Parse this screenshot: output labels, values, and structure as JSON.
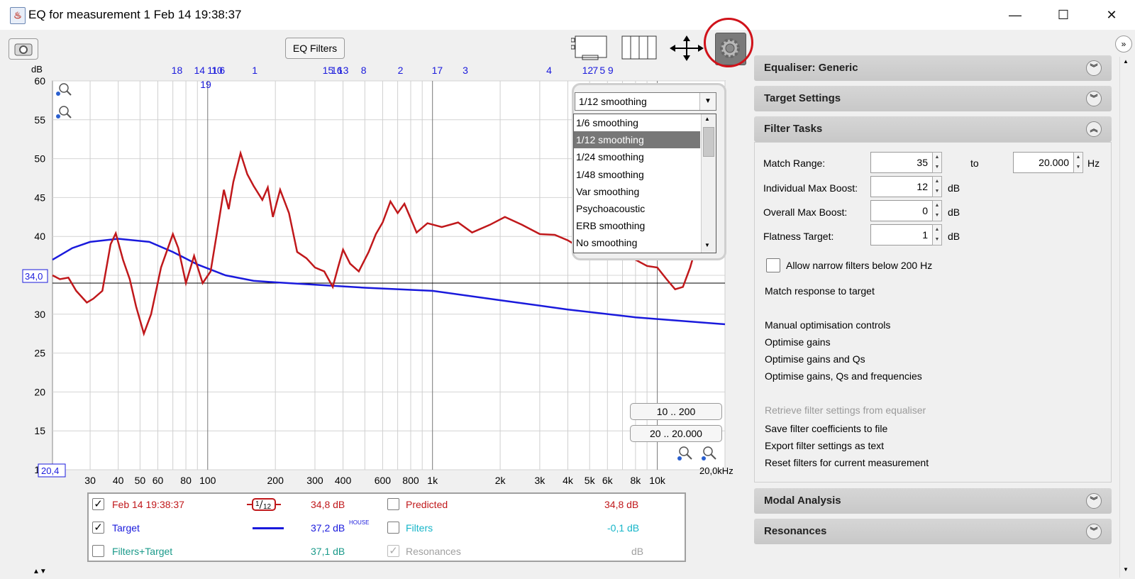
{
  "window": {
    "title": "EQ for measurement 1 Feb 14 19:38:37",
    "min": "—",
    "max": "☐",
    "close": "✕"
  },
  "toolbar": {
    "eq_filters": "EQ Filters"
  },
  "graph": {
    "y_unit": "dB",
    "y_ticks": [
      "60",
      "55",
      "50",
      "45",
      "40",
      "35",
      "30",
      "25",
      "20",
      "15",
      "10"
    ],
    "x_ticks": [
      "30",
      "40",
      "50",
      "60",
      "80",
      "100",
      "200",
      "300",
      "400",
      "600",
      "800",
      "1k",
      "2k",
      "3k",
      "4k",
      "5k",
      "6k",
      "8k",
      "10k"
    ],
    "x_start": "20,4",
    "x_end": "20,0kHz",
    "ref_value": "34,0",
    "filter_markers": [
      "18",
      "14",
      "11",
      "10",
      "6",
      "1",
      "15",
      "16",
      "13",
      "8",
      "2",
      "17",
      "3",
      "4",
      "7",
      "9",
      "12",
      "5",
      "19"
    ],
    "colors": {
      "measurement": "#c0181b",
      "target": "#1a1adc",
      "grid": "#c8c8c8"
    }
  },
  "smoothing": {
    "selected": "1/12 smoothing",
    "options": [
      "1/6 smoothing",
      "1/12 smoothing",
      "1/24 smoothing",
      "1/48 smoothing",
      "Var smoothing",
      "Psychoacoustic",
      "ERB smoothing",
      "No  smoothing"
    ],
    "selected_index": 1
  },
  "ranges": {
    "r1": "10 .. 200",
    "r2": "20 .. 20.000"
  },
  "legend": {
    "meas_name": "Feb 14 19:38:37",
    "meas_smooth_num": "1",
    "meas_smooth_den": "12",
    "meas_val": "34,8 dB",
    "predicted": "Predicted",
    "predicted_val": "34,8 dB",
    "target": "Target",
    "target_val": "37,2 dB",
    "target_sup": "HOUSE",
    "filters": "Filters",
    "filters_val": "-0,1 dB",
    "filters_target": "Filters+Target",
    "filters_target_val": "37,1 dB",
    "resonances": "Resonances",
    "resonances_val": "dB",
    "check": "✓"
  },
  "panel": {
    "equaliser": "Equaliser: Generic",
    "target_settings": "Target Settings",
    "filter_tasks": "Filter Tasks",
    "match_range_label": "Match Range:",
    "match_from": "35",
    "to": "to",
    "match_to": "20.000",
    "hz": "Hz",
    "ind_boost_label": "Individual Max Boost:",
    "ind_boost": "12",
    "overall_boost_label": "Overall Max Boost:",
    "overall_boost": "0",
    "flatness_label": "Flatness Target:",
    "flatness": "1",
    "db": "dB",
    "allow_narrow": "Allow narrow filters below 200 Hz",
    "match_response": "Match response to target",
    "manual_opt": "Manual optimisation controls",
    "opt_gains": "Optimise gains",
    "opt_gains_qs": "Optimise gains and Qs",
    "opt_gains_qs_freq": "Optimise gains, Qs and frequencies",
    "retrieve": "Retrieve filter settings from equaliser",
    "save_coeff": "Save filter coefficients to file",
    "export_text": "Export filter settings as text",
    "reset_filters": "Reset filters for current measurement",
    "modal": "Modal Analysis",
    "resonances": "Resonances"
  }
}
